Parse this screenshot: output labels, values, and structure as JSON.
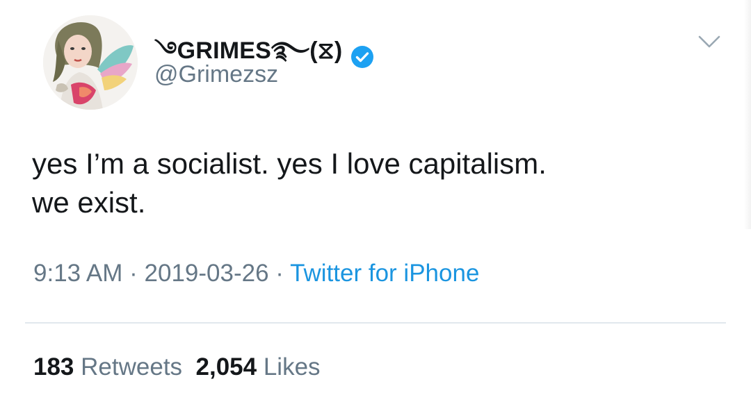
{
  "user": {
    "display_name": "࿓GRIMES࿐(⧖)",
    "handle": "@Grimezsz",
    "verified": true,
    "avatar_icon": "avatar-illustration"
  },
  "tweet": {
    "text_line1": "yes I’m a socialist. yes I love capitalism.",
    "text_line2": "we exist.",
    "time": "9:13 AM",
    "date": "2019-03-26",
    "separator": " · ",
    "source": "Twitter for iPhone"
  },
  "stats": {
    "retweets_count": "183",
    "retweets_label": "Retweets",
    "likes_count": "2,054",
    "likes_label": "Likes"
  },
  "colors": {
    "text": "#14171a",
    "secondary": "#657786",
    "link": "#1b95e0",
    "verified": "#1da1f2",
    "divider": "#e1e8ed"
  },
  "icons": {
    "verified": "verified-badge-icon",
    "menu": "chevron-down-icon"
  }
}
